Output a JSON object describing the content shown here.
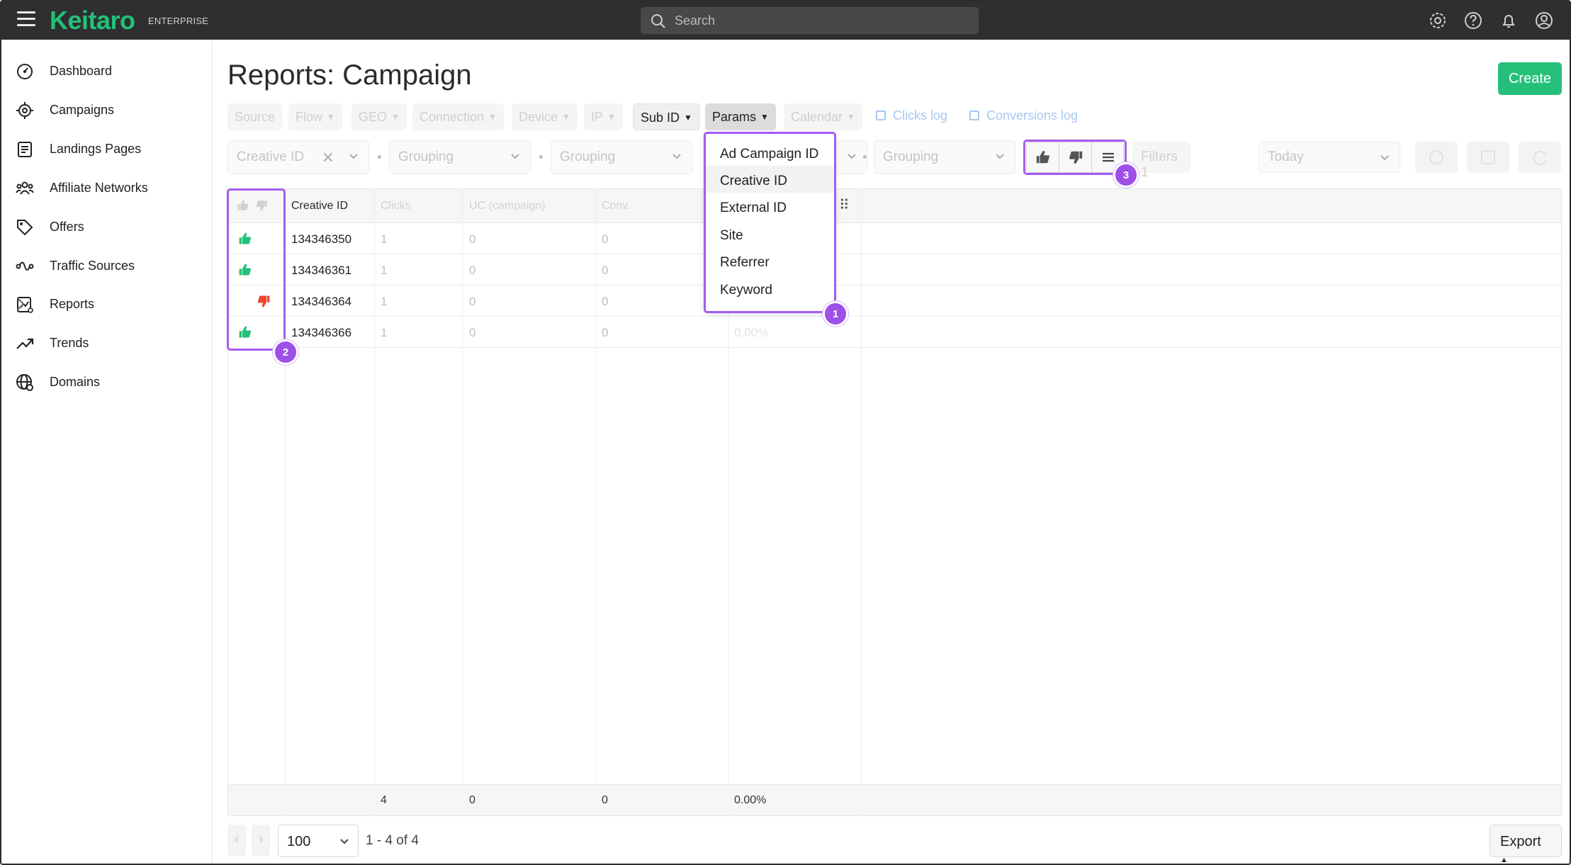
{
  "app": {
    "logo": "Keitaro",
    "edition": "ENTERPRISE"
  },
  "search": {
    "placeholder": "Search"
  },
  "sidebar": {
    "items": [
      {
        "label": "Dashboard",
        "icon": "dashboard-icon"
      },
      {
        "label": "Campaigns",
        "icon": "target-icon"
      },
      {
        "label": "Landings Pages",
        "icon": "document-icon"
      },
      {
        "label": "Affiliate Networks",
        "icon": "people-icon"
      },
      {
        "label": "Offers",
        "icon": "tag-icon"
      },
      {
        "label": "Traffic Sources",
        "icon": "route-icon"
      },
      {
        "label": "Reports",
        "icon": "report-icon"
      },
      {
        "label": "Trends",
        "icon": "trend-icon"
      },
      {
        "label": "Domains",
        "icon": "globe-icon"
      }
    ]
  },
  "page": {
    "title": "Reports: Campaign",
    "create_label": "Create"
  },
  "filter_tabs": [
    "Source",
    "Flow",
    "GEO",
    "Connection",
    "Device",
    "IP",
    "Sub ID",
    "Params",
    "Calendar"
  ],
  "links": {
    "clicks_log": "Clicks log",
    "conversions_log": "Conversions log"
  },
  "grouping": {
    "first": "Creative ID",
    "placeholder": "Grouping",
    "filters_label": "Filters",
    "filters_count": "1",
    "date_range": "Today"
  },
  "params_menu": {
    "options": [
      "Ad Campaign ID",
      "Creative ID",
      "External ID",
      "Site",
      "Referrer",
      "Keyword"
    ],
    "selected": "Creative ID"
  },
  "table": {
    "headers": [
      "Creative ID",
      "Clicks",
      "UC (campaign)",
      "Conv."
    ],
    "rows": [
      {
        "vote": "up",
        "id": "134346350",
        "clicks": "1",
        "uc": "0",
        "conv": "0"
      },
      {
        "vote": "up",
        "id": "134346361",
        "clicks": "1",
        "uc": "0",
        "conv": "0"
      },
      {
        "vote": "down",
        "id": "134346364",
        "clicks": "1",
        "uc": "0",
        "conv": "0"
      },
      {
        "vote": "up",
        "id": "134346366",
        "clicks": "1",
        "uc": "0",
        "conv": "0",
        "rate": "0.00%"
      }
    ],
    "totals": {
      "clicks": "4",
      "uc": "0",
      "conv": "0",
      "rate": "0.00%"
    }
  },
  "pagination": {
    "per_page": "100",
    "info": "1 - 4 of 4",
    "export_label": "Export"
  },
  "annotations": [
    "1",
    "2",
    "3"
  ],
  "colors": {
    "brand": "#22c17a",
    "thumb_up": "#22c17a",
    "thumb_down": "#f0442c",
    "highlight": "#a45cf0"
  }
}
